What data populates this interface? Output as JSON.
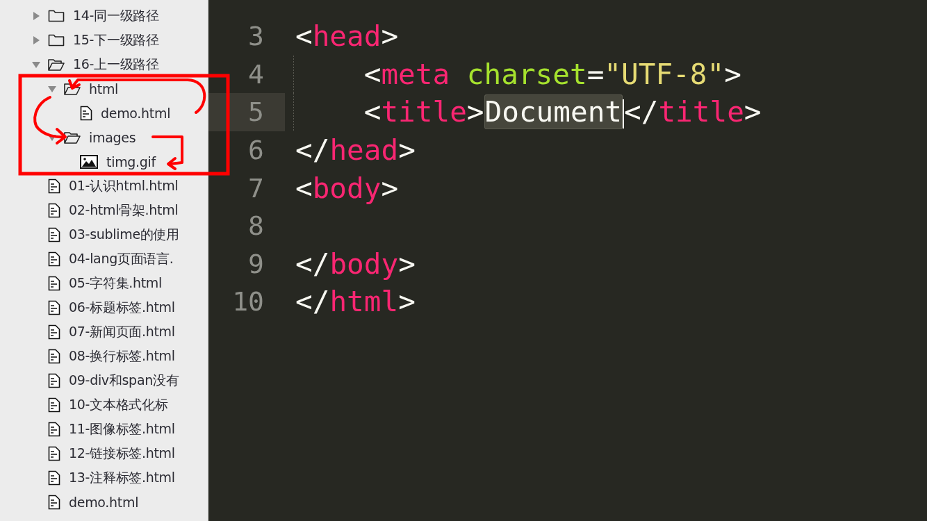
{
  "sidebar": {
    "items": [
      {
        "kind": "folder",
        "label": "14-同一级路径",
        "expanded": false
      },
      {
        "kind": "folder",
        "label": "15-下一级路径",
        "expanded": false
      },
      {
        "kind": "folder",
        "label": "16-上一级路径",
        "expanded": true,
        "children": [
          {
            "kind": "folder",
            "label": "html",
            "expanded": true,
            "children": [
              {
                "kind": "file",
                "label": "demo.html"
              }
            ]
          },
          {
            "kind": "folder",
            "label": "images",
            "expanded": true,
            "children": [
              {
                "kind": "image",
                "label": "timg.gif"
              }
            ]
          }
        ]
      },
      {
        "kind": "file",
        "label": "01-认识html.html"
      },
      {
        "kind": "file",
        "label": "02-html骨架.html"
      },
      {
        "kind": "file",
        "label": "03-sublime的使用"
      },
      {
        "kind": "file",
        "label": "04-lang页面语言."
      },
      {
        "kind": "file",
        "label": "05-字符集.html"
      },
      {
        "kind": "file",
        "label": "06-标题标签.html"
      },
      {
        "kind": "file",
        "label": "07-新闻页面.html"
      },
      {
        "kind": "file",
        "label": "08-换行标签.html"
      },
      {
        "kind": "file",
        "label": "09-div和span没有"
      },
      {
        "kind": "file",
        "label": "10-文本格式化标"
      },
      {
        "kind": "file",
        "label": "11-图像标签.html"
      },
      {
        "kind": "file",
        "label": "12-链接标签.html"
      },
      {
        "kind": "file",
        "label": "13-注释标签.html"
      },
      {
        "kind": "file",
        "label": "demo.html"
      }
    ]
  },
  "editor": {
    "lines": [
      {
        "number": "3",
        "current": false,
        "tokens": [
          {
            "kind": "punct",
            "text": "<"
          },
          {
            "kind": "tag",
            "text": "head"
          },
          {
            "kind": "punct",
            "text": ">"
          }
        ]
      },
      {
        "number": "4",
        "current": false,
        "tokens": [
          {
            "kind": "punct",
            "text": "    <"
          },
          {
            "kind": "tag",
            "text": "meta"
          },
          {
            "kind": "attr",
            "text": " charset"
          },
          {
            "kind": "punct",
            "text": "="
          },
          {
            "kind": "string",
            "text": "\"UTF-8\""
          },
          {
            "kind": "punct",
            "text": ">"
          }
        ]
      },
      {
        "number": "5",
        "current": true,
        "tokens": [
          {
            "kind": "punct",
            "text": "    <"
          },
          {
            "kind": "tag",
            "text": "title"
          },
          {
            "kind": "punct",
            "text": ">"
          },
          {
            "kind": "selection",
            "text": "Document",
            "caret_after": true
          },
          {
            "kind": "punct",
            "text": "</"
          },
          {
            "kind": "tag",
            "text": "title"
          },
          {
            "kind": "punct",
            "text": ">"
          }
        ]
      },
      {
        "number": "6",
        "current": false,
        "tokens": [
          {
            "kind": "punct",
            "text": "</"
          },
          {
            "kind": "tag",
            "text": "head"
          },
          {
            "kind": "punct",
            "text": ">"
          }
        ]
      },
      {
        "number": "7",
        "current": false,
        "tokens": [
          {
            "kind": "punct",
            "text": "<"
          },
          {
            "kind": "tag",
            "text": "body"
          },
          {
            "kind": "punct",
            "text": ">"
          }
        ]
      },
      {
        "number": "8",
        "current": false
      },
      {
        "number": "9",
        "current": false,
        "tokens": [
          {
            "kind": "punct",
            "text": "</"
          },
          {
            "kind": "tag",
            "text": "body"
          },
          {
            "kind": "punct",
            "text": ">"
          }
        ]
      },
      {
        "number": "10",
        "current": false,
        "tokens": [
          {
            "kind": "punct",
            "text": "</"
          },
          {
            "kind": "tag",
            "text": "html"
          },
          {
            "kind": "punct",
            "text": ">"
          }
        ]
      }
    ]
  }
}
